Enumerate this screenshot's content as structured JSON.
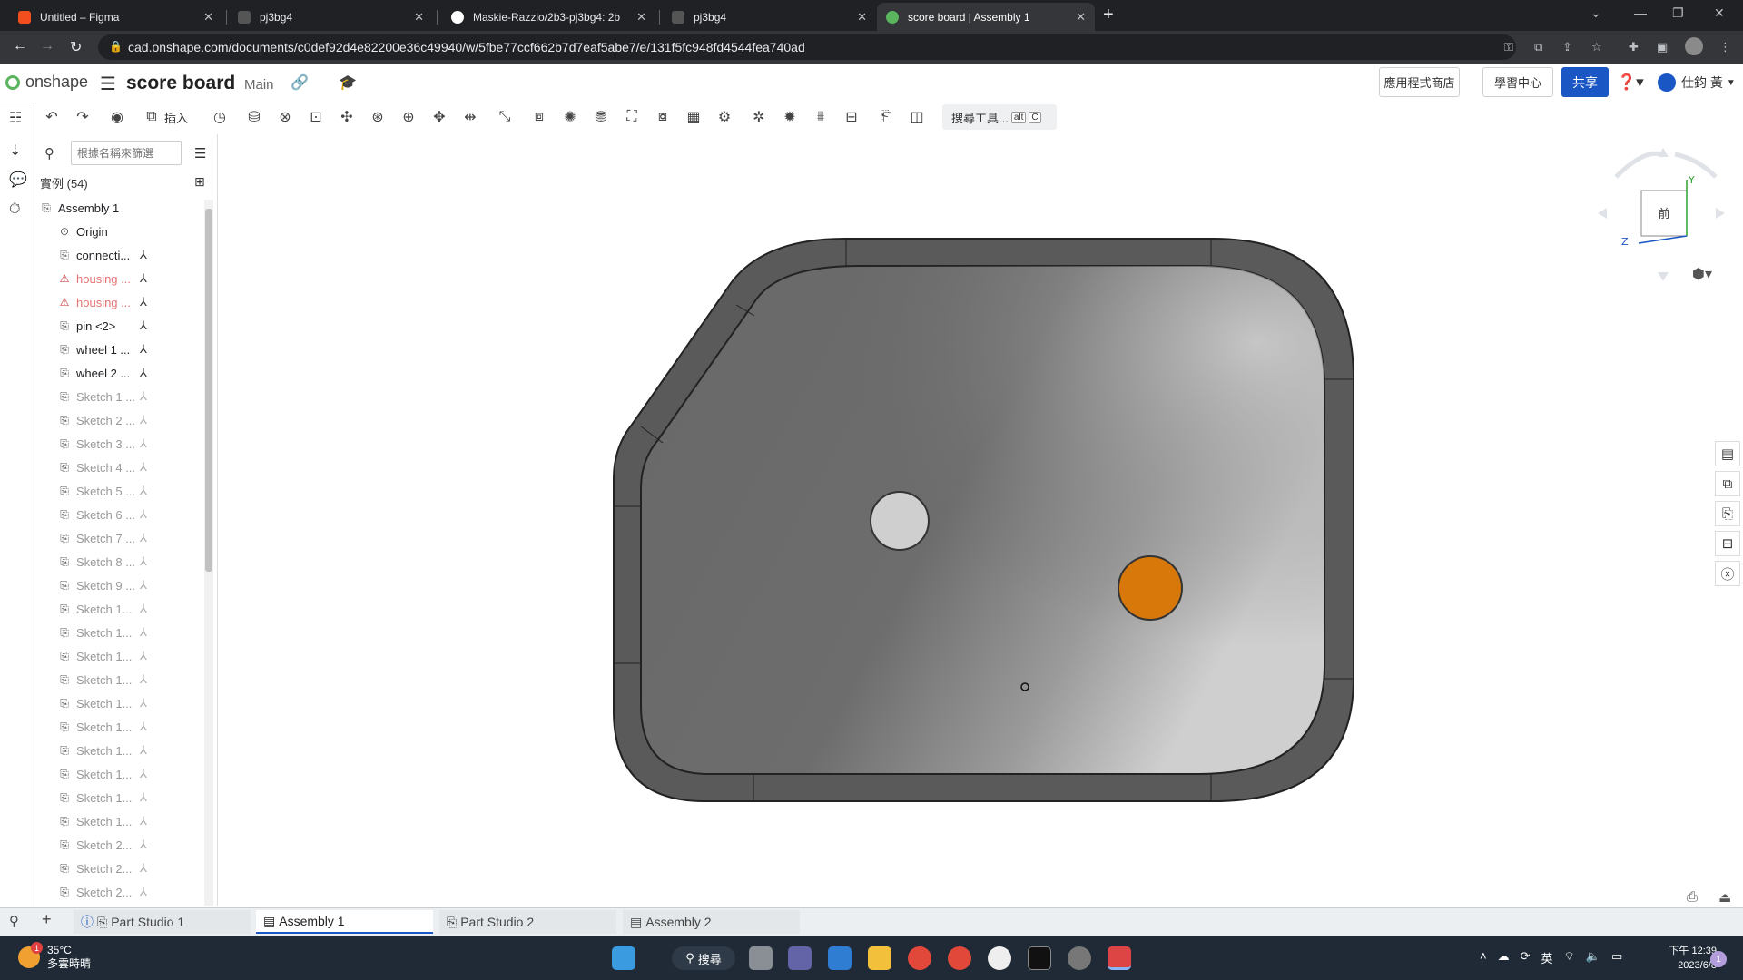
{
  "browser": {
    "tabs": [
      {
        "label": "Untitled – Figma",
        "color": "#f24e1e"
      },
      {
        "label": "pj3bg4",
        "color": "#333333"
      },
      {
        "label": "Maskie-Razzio/2b3-pj3bg4: 2b",
        "color": "#ffffff"
      },
      {
        "label": "pj3bg4",
        "color": "#333333"
      },
      {
        "label": "score board | Assembly 1",
        "color": "#5bb55f"
      }
    ],
    "url": "cad.onshape.com/documents/c0def92d4e82200e36c49940/w/5fbe77ccf662b7d7eaf5abe7/e/131f5fc948fd4544fea740ad"
  },
  "app": {
    "logo": "onshape",
    "doc_title": "score board",
    "branch": "Main",
    "app_store": "應用程式商店",
    "learning": "學習中心",
    "share": "共享",
    "user": "仕鈞 黃",
    "accent": "#1a56c4"
  },
  "toolbar": {
    "insert_label": "插入",
    "search_tools": "搜尋工具...",
    "shortcut_a": "alt",
    "shortcut_b": "C"
  },
  "panel": {
    "search_placeholder": "根據名稱來篩選",
    "instances_label": "實例 (54)",
    "items": [
      {
        "label": "Assembly 1",
        "state": "normal"
      },
      {
        "label": "Origin",
        "state": "normal"
      },
      {
        "label": "connecti...",
        "state": "normal"
      },
      {
        "label": "housing ...",
        "state": "error"
      },
      {
        "label": "housing ...",
        "state": "error"
      },
      {
        "label": "pin <2>",
        "state": "normal"
      },
      {
        "label": "wheel 1 ...",
        "state": "normal"
      },
      {
        "label": "wheel 2 ...",
        "state": "normal"
      },
      {
        "label": "Sketch 1 ...",
        "state": "dim"
      },
      {
        "label": "Sketch 2 ...",
        "state": "dim"
      },
      {
        "label": "Sketch 3 ...",
        "state": "dim"
      },
      {
        "label": "Sketch 4 ...",
        "state": "dim"
      },
      {
        "label": "Sketch 5 ...",
        "state": "dim"
      },
      {
        "label": "Sketch 6 ...",
        "state": "dim"
      },
      {
        "label": "Sketch 7 ...",
        "state": "dim"
      },
      {
        "label": "Sketch 8 ...",
        "state": "dim"
      },
      {
        "label": "Sketch 9 ...",
        "state": "dim"
      },
      {
        "label": "Sketch 1...",
        "state": "dim"
      },
      {
        "label": "Sketch 1...",
        "state": "dim"
      },
      {
        "label": "Sketch 1...",
        "state": "dim"
      },
      {
        "label": "Sketch 1...",
        "state": "dim"
      },
      {
        "label": "Sketch 1...",
        "state": "dim"
      },
      {
        "label": "Sketch 1...",
        "state": "dim"
      },
      {
        "label": "Sketch 1...",
        "state": "dim"
      },
      {
        "label": "Sketch 1...",
        "state": "dim"
      },
      {
        "label": "Sketch 1...",
        "state": "dim"
      },
      {
        "label": "Sketch 1...",
        "state": "dim"
      },
      {
        "label": "Sketch 2...",
        "state": "dim"
      },
      {
        "label": "Sketch 2...",
        "state": "dim"
      },
      {
        "label": "Sketch 2...",
        "state": "dim"
      }
    ]
  },
  "viewport": {
    "view_label": "前",
    "axis_y": "Y",
    "axis_z": "Z",
    "board_color": "#6b6b6b",
    "button_grey_color": "#cfcfcf",
    "button_orange_color": "#d9780a"
  },
  "tabs_bottom": [
    {
      "label": "Part Studio 1"
    },
    {
      "label": "Assembly 1"
    },
    {
      "label": "Part Studio 2"
    },
    {
      "label": "Assembly 2"
    }
  ],
  "taskbar": {
    "temp": "35°C",
    "weather": "多雲時晴",
    "weather_badge": "1",
    "search": "搜尋",
    "ime": "英",
    "time": "下午 12:39",
    "date": "2023/6/8",
    "notifications": "1"
  }
}
